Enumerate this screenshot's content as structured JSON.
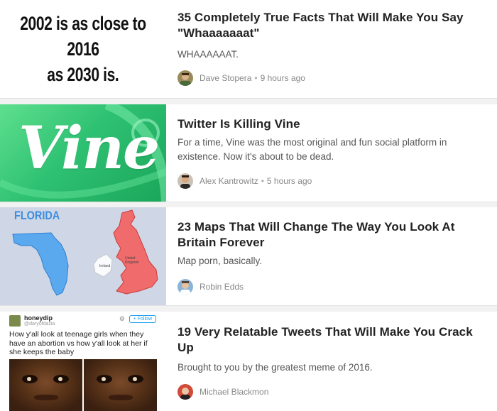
{
  "articles": [
    {
      "title": "35 Completely True Facts That Will Make You Say \"Whaaaaaaat\"",
      "description": "WHAAAAAAT.",
      "author": "Dave Stopera",
      "time": "9 hours ago",
      "thumb_text": [
        "2002 is as close to 2016",
        "as 2030 is."
      ]
    },
    {
      "title": "Twitter Is Killing Vine",
      "description": "For a time, Vine was the most original and fun social platform in existence. Now it's about to be dead.",
      "author": "Alex Kantrowitz",
      "time": "5 hours ago",
      "thumb_text": "Vine"
    },
    {
      "title": "23 Maps That Will Change The Way You Look At Britain Forever",
      "description": "Map porn, basically.",
      "author": "Robin Edds",
      "thumb_text": "FLORIDA"
    },
    {
      "title": "19 Very Relatable Tweets That Will Make You Crack Up",
      "description": "Brought to you by the greatest meme of 2016.",
      "author": "Michael Blackmon",
      "tweet": {
        "name": "honeydip",
        "handle": "@daryofdazia",
        "follow": "Follow",
        "text": "How y'all look at teenage girls when they have an abortion vs how y'all look at her if she keeps the baby"
      }
    }
  ],
  "separator": "•",
  "icons": {
    "gear": "gear-icon",
    "follow": "follow-icon"
  }
}
